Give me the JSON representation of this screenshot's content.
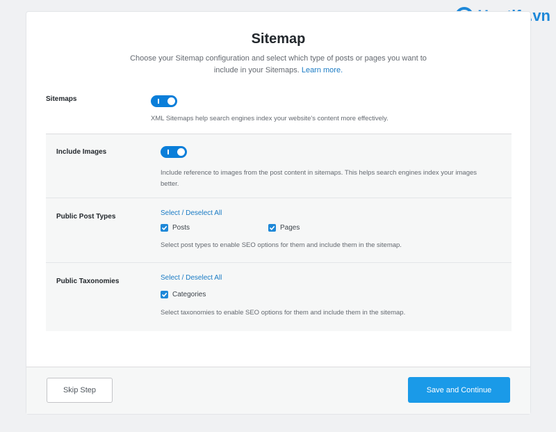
{
  "brand": {
    "name": "Hostify.vn",
    "color": "#1e88d8"
  },
  "header": {
    "title": "Sitemap",
    "subtitle": "Choose your Sitemap configuration and select which type of posts or pages you want to include in your Sitemaps.",
    "learn_more": "Learn more."
  },
  "sitemaps": {
    "label": "Sitemaps",
    "enabled": true,
    "description": "XML Sitemaps help search engines index your website's content more effectively."
  },
  "include_images": {
    "label": "Include Images",
    "enabled": true,
    "description": "Include reference to images from the post content in sitemaps. This helps search engines index your images better."
  },
  "post_types": {
    "label": "Public Post Types",
    "select_all": "Select / Deselect All",
    "items": [
      {
        "label": "Posts",
        "checked": true
      },
      {
        "label": "Pages",
        "checked": true
      }
    ],
    "description": "Select post types to enable SEO options for them and include them in the sitemap."
  },
  "taxonomies": {
    "label": "Public Taxonomies",
    "select_all": "Select / Deselect All",
    "items": [
      {
        "label": "Categories",
        "checked": true
      }
    ],
    "description": "Select taxonomies to enable SEO options for them and include them in the sitemap."
  },
  "footer": {
    "skip_label": "Skip Step",
    "save_label": "Save and Continue"
  },
  "colors": {
    "accent": "#1a9ae8",
    "toggle": "#0a7ed9",
    "link": "#1a7bc4"
  }
}
